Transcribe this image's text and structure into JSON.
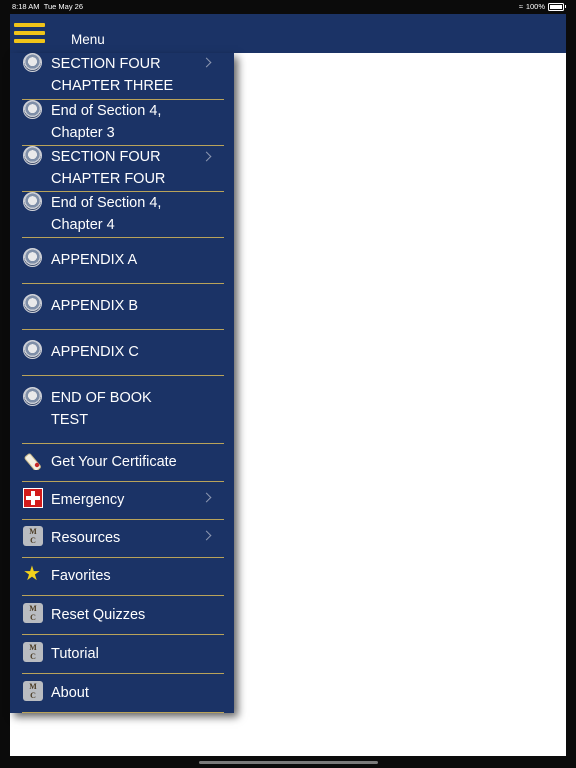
{
  "status_bar": {
    "time": "8:18 AM",
    "date": "Tue May 26",
    "battery": "100%"
  },
  "nav": {
    "title": "Menu",
    "menu_icon": "hamburger-icon"
  },
  "menu": {
    "items": [
      {
        "label1": "SECTION FOUR",
        "label2": "CHAPTER THREE",
        "icon": "navy-seal-icon",
        "chevron": true
      },
      {
        "label1": "End of Section 4,",
        "label2": "Chapter 3",
        "icon": "navy-seal-icon",
        "chevron": false
      },
      {
        "label1": "SECTION FOUR",
        "label2": "CHAPTER FOUR",
        "icon": "navy-seal-icon",
        "chevron": true
      },
      {
        "label1": "End of Section 4,",
        "label2": "Chapter 4",
        "icon": "navy-seal-icon",
        "chevron": false
      },
      {
        "label1": "APPENDIX A",
        "icon": "navy-seal-icon"
      },
      {
        "label1": "APPENDIX B",
        "icon": "navy-seal-icon"
      },
      {
        "label1": "APPENDIX C",
        "icon": "navy-seal-icon"
      },
      {
        "label1": "END OF BOOK",
        "label2": "TEST",
        "icon": "navy-seal-icon"
      },
      {
        "label1": "Get Your Certificate",
        "icon": "certificate-scroll-icon"
      },
      {
        "label1": "Emergency",
        "icon": "red-cross-icon",
        "chevron": true
      },
      {
        "label1": "Resources",
        "icon": "mc-logo-icon",
        "chevron": true
      },
      {
        "label1": "Favorites",
        "icon": "star-icon"
      },
      {
        "label1": "Reset Quizzes",
        "icon": "mc-logo-icon"
      },
      {
        "label1": "Tutorial",
        "icon": "mc-logo-icon"
      },
      {
        "label1": "About",
        "icon": "mc-logo-icon"
      }
    ]
  },
  "mc_logo_text": {
    "top": "M",
    "bottom": "C"
  },
  "colors": {
    "navy": "#1b3366",
    "divider": "#b9a35a",
    "accent": "#f0c419"
  }
}
